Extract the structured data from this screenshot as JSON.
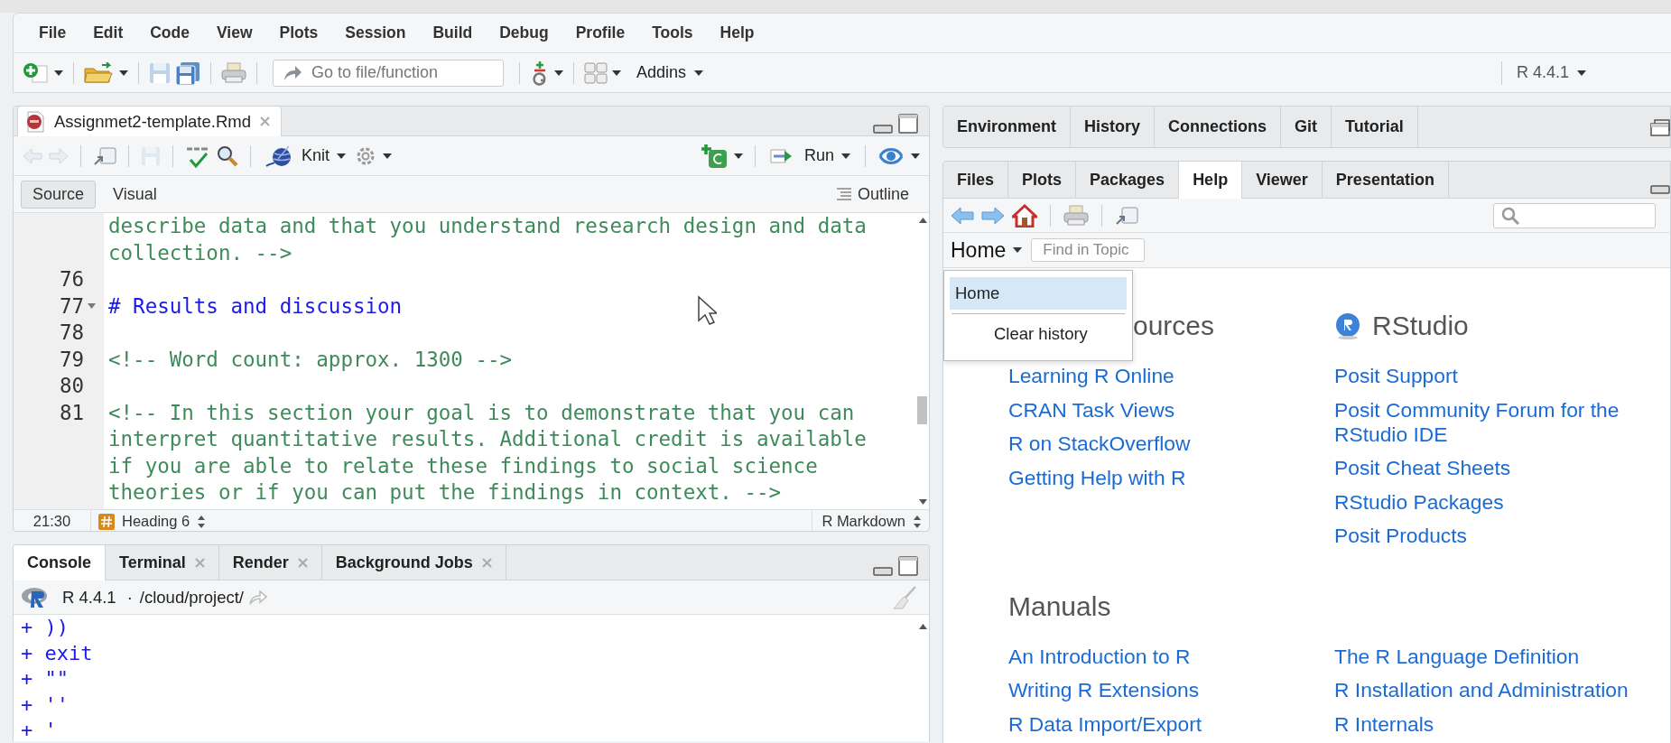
{
  "menu": [
    "File",
    "Edit",
    "Code",
    "View",
    "Plots",
    "Session",
    "Build",
    "Debug",
    "Profile",
    "Tools",
    "Help"
  ],
  "toolbar": {
    "goto_placeholder": "Go to file/function",
    "addins": "Addins",
    "r_version": "R 4.4.1"
  },
  "editor": {
    "tabs": [
      {
        "label": "Assignmet2-template.Rmd",
        "selected": true
      }
    ],
    "knit": "Knit",
    "run": "Run",
    "modes": [
      {
        "label": "Source",
        "selected": true
      },
      {
        "label": "Visual",
        "selected": false
      }
    ],
    "outline": "Outline",
    "lines": [
      {
        "kind": "comment",
        "foldable": false,
        "text": "describe data and that you understand research design and data collection. -->"
      },
      {
        "number": "76",
        "kind": "blank",
        "foldable": false
      },
      {
        "number": "77",
        "kind": "heading",
        "foldable": true,
        "text": "# Results and discussion"
      },
      {
        "number": "78",
        "kind": "blank",
        "foldable": false
      },
      {
        "number": "79",
        "kind": "comment",
        "foldable": false,
        "text": "<!-- Word count: approx. 1300 -->"
      },
      {
        "number": "80",
        "kind": "blank",
        "foldable": false
      },
      {
        "number": "81",
        "kind": "comment",
        "foldable": false,
        "text": "<!-- In this section your goal is to demonstrate that you can interpret quantitative results. Additional credit is available if you are able to relate these findings to social science theories or if you can put the findings in context. -->"
      }
    ],
    "status": {
      "position": "21:30",
      "section": "Heading 6",
      "filetype": "R Markdown"
    }
  },
  "console": {
    "tabs": [
      {
        "label": "Console",
        "selected": true,
        "closable": false
      },
      {
        "label": "Terminal",
        "selected": false,
        "closable": true
      },
      {
        "label": "Render",
        "selected": false,
        "closable": true
      },
      {
        "label": "Background Jobs",
        "selected": false,
        "closable": true
      }
    ],
    "r_version": "R 4.4.1",
    "separator": "·",
    "path": "/cloud/project/",
    "lines": [
      "+ ))",
      "+ exit",
      "+ \"\"",
      "+ ''",
      "+ '"
    ]
  },
  "environment_pane": {
    "tabs": [
      {
        "label": "Environment",
        "selected": false
      },
      {
        "label": "History",
        "selected": false
      },
      {
        "label": "Connections",
        "selected": false
      },
      {
        "label": "Git",
        "selected": false
      },
      {
        "label": "Tutorial",
        "selected": false
      }
    ]
  },
  "help_pane": {
    "tabs": [
      {
        "label": "Files",
        "selected": false
      },
      {
        "label": "Plots",
        "selected": false
      },
      {
        "label": "Packages",
        "selected": false
      },
      {
        "label": "Help",
        "selected": true
      },
      {
        "label": "Viewer",
        "selected": false
      },
      {
        "label": "Presentation",
        "selected": false
      }
    ],
    "topic": "Home",
    "find_placeholder": "Find in Topic",
    "history_menu": [
      {
        "label": "Home",
        "selected": true
      },
      {
        "label": "Clear history",
        "selected": false
      }
    ],
    "sections": [
      {
        "kind": "covered",
        "heading": "ources",
        "links": [
          "Learning R Online",
          "CRAN Task Views",
          "R on StackOverflow",
          "Getting Help with R"
        ]
      },
      {
        "kind": "logo",
        "heading": "RStudio",
        "links": [
          "Posit Support",
          "Posit Community Forum for the RStudio IDE",
          "Posit Cheat Sheets",
          "RStudio Packages",
          "Posit Products"
        ]
      }
    ],
    "manuals": {
      "heading": "Manuals",
      "links": [
        "An Introduction to R",
        "The R Language Definition",
        "Writing R Extensions",
        "R Installation and Administration",
        "R Data Import/Export",
        "R Internals"
      ]
    }
  }
}
